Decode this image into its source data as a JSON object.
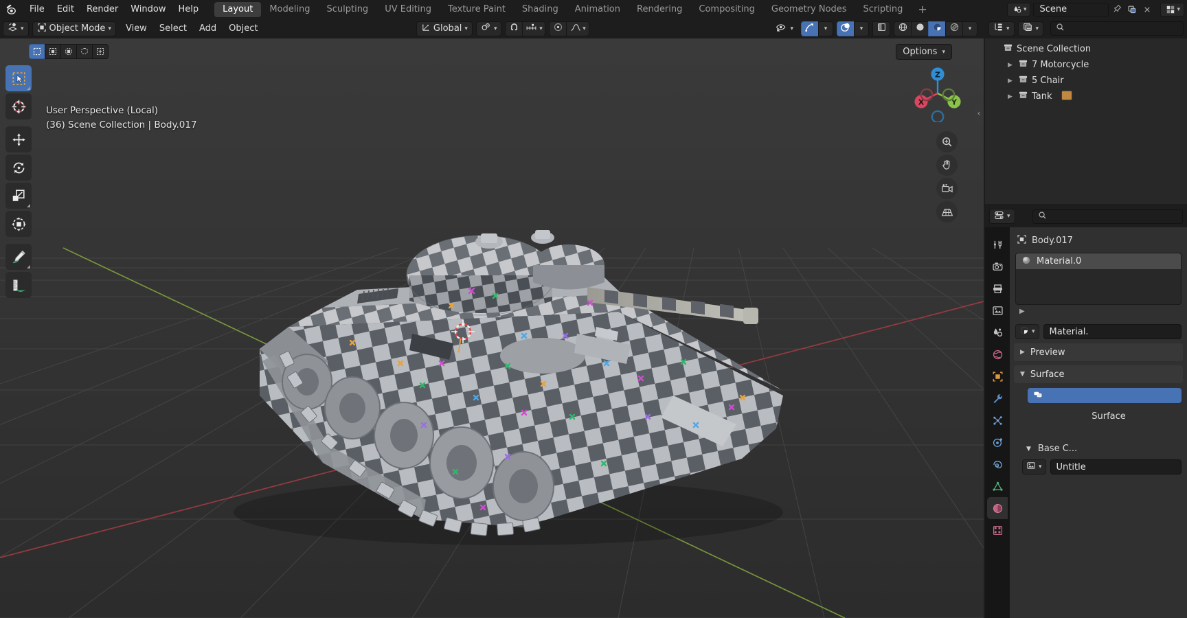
{
  "topbar": {
    "logo_icon": "blender-logo-icon",
    "menus": [
      "File",
      "Edit",
      "Render",
      "Window",
      "Help"
    ],
    "workspace_tabs": [
      {
        "label": "Layout",
        "active": true
      },
      {
        "label": "Modeling",
        "active": false
      },
      {
        "label": "Sculpting",
        "active": false
      },
      {
        "label": "UV Editing",
        "active": false
      },
      {
        "label": "Texture Paint",
        "active": false
      },
      {
        "label": "Shading",
        "active": false
      },
      {
        "label": "Animation",
        "active": false
      },
      {
        "label": "Rendering",
        "active": false
      },
      {
        "label": "Compositing",
        "active": false
      },
      {
        "label": "Geometry Nodes",
        "active": false
      },
      {
        "label": "Scripting",
        "active": false
      }
    ],
    "add_workspace_label": "+",
    "scene_icon": "scene-data-icon",
    "scene_name": "Scene",
    "pin_icon": "pin-icon",
    "copy_icon": "duplicate-scene-icon",
    "close_icon": "close-icon",
    "view_layer_icon": "view-layer-icon"
  },
  "viewport_header": {
    "editor_type_icon": "editor-type-3dview-icon",
    "mode_icon": "object-mode-icon",
    "mode_label": "Object Mode",
    "menus": [
      "View",
      "Select",
      "Add",
      "Object"
    ],
    "orientation_icon": "transform-orientation-icon",
    "orientation_label": "Global",
    "pivot_icon": "pivot-point-icon",
    "snap_magnet_icon": "snap-magnet-icon",
    "snap_target_icon": "snap-increment-icon",
    "proportional_icon": "proportional-editing-icon",
    "proportional_falloff_icon": "falloff-smooth-icon",
    "visibility_icon": "object-visibility-icon",
    "gizmo_icon": "gizmo-icon",
    "overlays_icon": "overlays-icon",
    "xray_icon": "xray-toggle-icon",
    "shading_modes": [
      {
        "name": "wireframe-shading-icon",
        "active": false
      },
      {
        "name": "solid-shading-icon",
        "active": false
      },
      {
        "name": "material-preview-shading-icon",
        "active": true
      },
      {
        "name": "rendered-shading-icon",
        "active": false
      }
    ],
    "shading_dropdown_icon": "chevron-down-icon"
  },
  "viewport": {
    "select_modes": [
      {
        "name": "select-tweak-icon",
        "active": true
      },
      {
        "name": "select-box-icon",
        "active": false
      },
      {
        "name": "select-circle-icon",
        "active": false
      },
      {
        "name": "select-lasso-icon",
        "active": false
      },
      {
        "name": "select-extend-icon",
        "active": false
      }
    ],
    "options_label": "Options",
    "options_chevron_icon": "chevron-down-icon",
    "overlay_line1": "User Perspective (Local)",
    "overlay_line2": "(36) Scene Collection | Body.017",
    "toolbar": [
      {
        "name": "tweak-tool-icon",
        "label": "Tweak",
        "active": true,
        "has_corner": true
      },
      {
        "name": "cursor-tool-icon",
        "label": "Cursor",
        "active": false,
        "has_corner": false
      },
      {
        "name": "move-tool-icon",
        "label": "Move",
        "active": false,
        "has_corner": false
      },
      {
        "name": "rotate-tool-icon",
        "label": "Rotate",
        "active": false,
        "has_corner": false
      },
      {
        "name": "scale-tool-icon",
        "label": "Scale",
        "active": false,
        "has_corner": true
      },
      {
        "name": "transform-tool-icon",
        "label": "Transform",
        "active": false,
        "has_corner": false
      },
      {
        "name": "annotate-tool-icon",
        "label": "Annotate",
        "active": false,
        "has_corner": true
      },
      {
        "name": "measure-tool-icon",
        "label": "Measure",
        "active": false,
        "has_corner": false
      }
    ],
    "gizmo": {
      "x_label": "X",
      "y_label": "Y",
      "z_label": "Z",
      "x_color": "#d8465f",
      "y_color": "#8bc34a",
      "z_color": "#2e8fd8"
    },
    "nav_buttons": [
      {
        "name": "zoom-view-icon"
      },
      {
        "name": "pan-view-icon"
      },
      {
        "name": "camera-view-icon"
      },
      {
        "name": "toggle-perspective-icon"
      }
    ],
    "sidebar_toggle_icon": "chevron-left-icon",
    "cursor_3d_icon": "3d-cursor-icon"
  },
  "outliner": {
    "display_mode_icon": "outliner-display-mode-icon",
    "filter_icon": "outliner-filter-icon",
    "search_icon": "search-icon",
    "rows": [
      {
        "label": "Scene Collection",
        "icon": "collection-icon",
        "indent": 0,
        "expandable": false
      },
      {
        "label": "7 Motorcycle",
        "icon": "collection-icon",
        "indent": 1,
        "expandable": true
      },
      {
        "label": "5 Chair",
        "icon": "collection-icon",
        "indent": 1,
        "expandable": true
      },
      {
        "label": "Tank",
        "icon": "collection-icon",
        "indent": 1,
        "expandable": true
      }
    ]
  },
  "properties": {
    "editor_icon": "properties-editor-icon",
    "search_icon": "search-icon",
    "tabs": [
      {
        "name": "tool-properties-tab-icon",
        "active": false
      },
      {
        "name": "render-properties-tab-icon",
        "active": false
      },
      {
        "name": "output-properties-tab-icon",
        "active": false
      },
      {
        "name": "view-layer-properties-tab-icon",
        "active": false
      },
      {
        "name": "scene-properties-tab-icon",
        "active": false
      },
      {
        "name": "world-properties-tab-icon",
        "active": false
      },
      {
        "name": "object-properties-tab-icon",
        "active": false
      },
      {
        "name": "modifier-properties-tab-icon",
        "active": false
      },
      {
        "name": "particle-properties-tab-icon",
        "active": false
      },
      {
        "name": "physics-properties-tab-icon",
        "active": false
      },
      {
        "name": "constraint-properties-tab-icon",
        "active": false
      },
      {
        "name": "object-data-properties-tab-icon",
        "active": false
      },
      {
        "name": "material-properties-tab-icon",
        "active": true
      }
    ],
    "breadcrumb_icon": "object-icon",
    "breadcrumb_label": "Body.017",
    "material_slot": {
      "icon": "material-sphere-icon",
      "label": "Material.0",
      "selected": true
    },
    "slot_expand_icon": "expand-triangle-icon",
    "browse_material_icon": "browse-material-icon",
    "material_name": "Material.",
    "panels": [
      {
        "label": "Preview",
        "open": false,
        "icon": "collapse-triangle-icon"
      },
      {
        "label": "Surface",
        "open": true,
        "icon": "expand-triangle-icon"
      }
    ],
    "surface_node_icon": "node-surface-icon",
    "surface_field_label": "Surface",
    "base_color_label": "Base C...",
    "base_color_triangle_icon": "expand-triangle-icon",
    "texture_browse_icon": "browse-image-icon",
    "texture_name": "Untitle"
  },
  "colors": {
    "accent_blue": "#4772b3",
    "panel_bg": "#303030",
    "editor_bg": "#1d1d1d",
    "widget_bg": "#282828",
    "viewport_sky": "#3c3c3c",
    "viewport_floor": "#2e2e2e",
    "axis_x_red": "#9c3b44",
    "axis_y_green": "#7c9c3b"
  }
}
